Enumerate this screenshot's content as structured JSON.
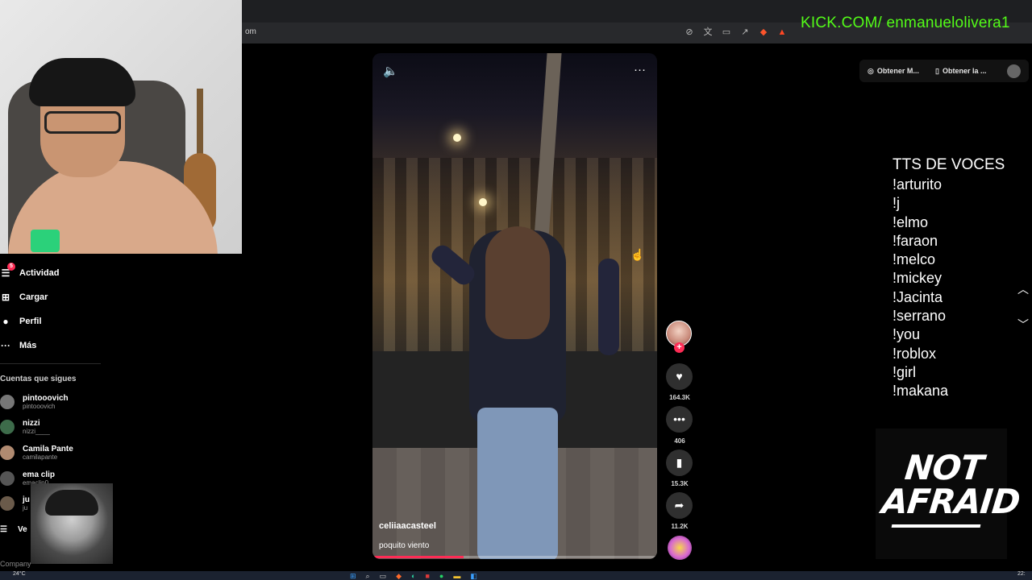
{
  "browser": {
    "url_fragment": "om",
    "toolbar_icons": [
      "mute-tab-icon",
      "translate-icon",
      "screenshot-icon",
      "share-icon",
      "brave-shields-icon",
      "brave-rewards-icon"
    ]
  },
  "overlay": {
    "kick_handle": "KICK.COM/ enmanuelolivera1",
    "tts_title": "TTS DE VOCES",
    "tts_commands": [
      "!arturito",
      "!j",
      "!elmo",
      "!faraon",
      "!melco",
      "!mickey",
      "!Jacinta",
      "!serrano",
      "!you",
      "!roblox",
      "!girl",
      "!makana"
    ],
    "logo_line1": "NOT",
    "logo_line2": "AFRAID"
  },
  "sidebar": {
    "nav": [
      {
        "label": "Actividad",
        "icon": "activity-icon",
        "badge": "5"
      },
      {
        "label": "Cargar",
        "icon": "upload-icon"
      },
      {
        "label": "Perfil",
        "icon": "profile-icon"
      },
      {
        "label": "Más",
        "icon": "more-icon"
      }
    ],
    "following_title": "Cuentas que sigues",
    "accounts": [
      {
        "name": "pintooovich",
        "handle": "pintooovich"
      },
      {
        "name": "nizzi",
        "handle": "nizzi____"
      },
      {
        "name": "Camila Pante",
        "handle": "camilapante"
      },
      {
        "name": "ema clip",
        "handle": "emaclip0"
      },
      {
        "name": "ju",
        "handle": "ju"
      }
    ],
    "see_more": "Ve",
    "footer": "Company"
  },
  "header": {
    "get_app_1": "Obtener M...",
    "get_app_2": "Obtener la ..."
  },
  "video": {
    "author": "celiiaacasteel",
    "caption": "poquito viento",
    "progress": 0.32,
    "likes": "164.3K",
    "comments": "406",
    "saves": "15.3K",
    "shares": "11.2K"
  },
  "taskbar": {
    "weather": "24°C",
    "time": "22:"
  },
  "colors": {
    "kick_green": "#53fc18",
    "tiktok_red": "#fe2c55",
    "background": "#000000"
  }
}
